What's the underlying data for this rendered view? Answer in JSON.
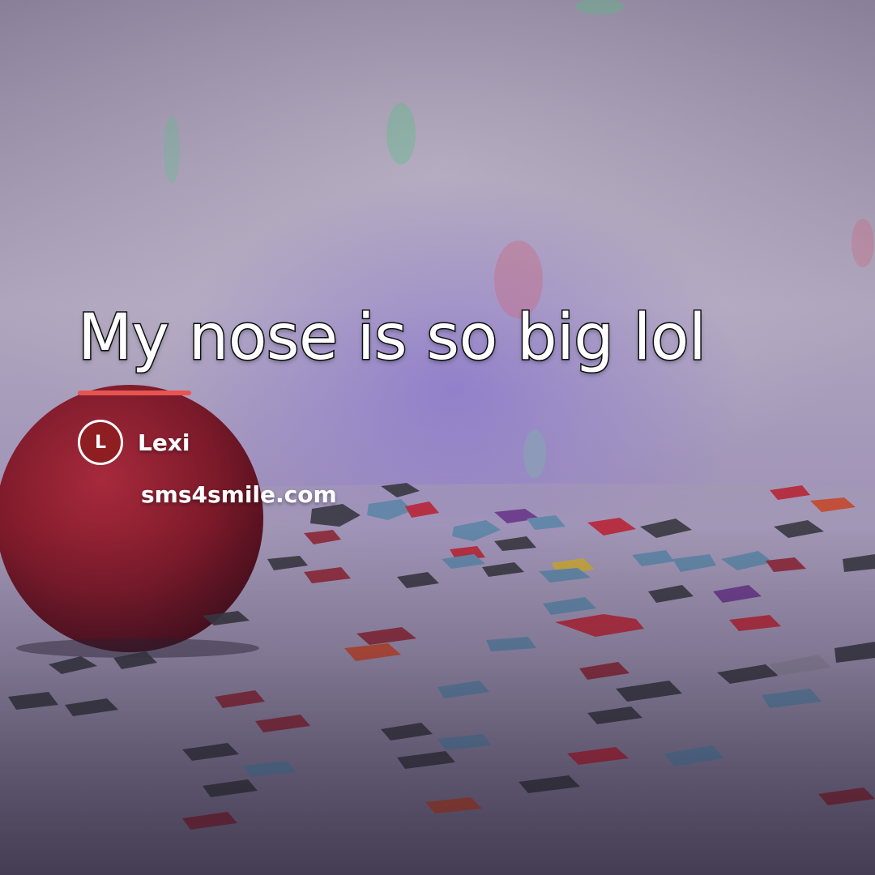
{
  "quote": {
    "text": "My nose is so big lol"
  },
  "author": {
    "initial": "L",
    "name": "Lexi"
  },
  "site": {
    "label": "sms4smile.com"
  },
  "colors": {
    "accent": "#e85450",
    "avatar_bg": "#8e1e22",
    "background_top": "#b9aec8",
    "background_bottom": "#3c3550",
    "clown_nose": "#7e1a2a"
  },
  "icons": {
    "avatar": "author-initial-avatar"
  }
}
